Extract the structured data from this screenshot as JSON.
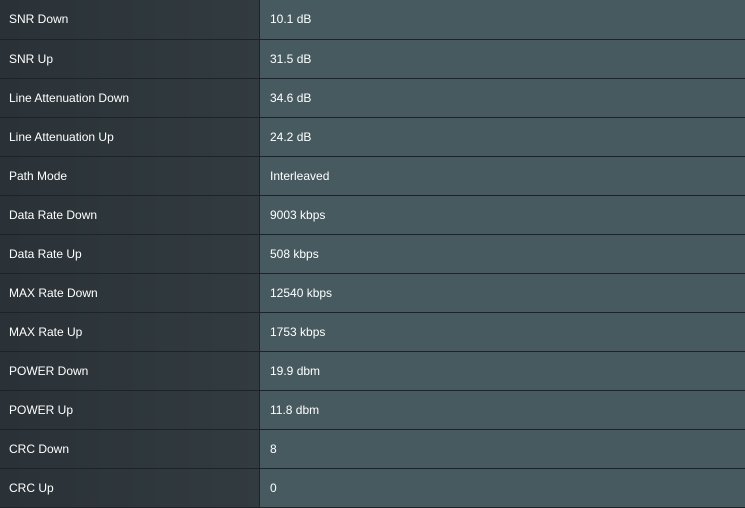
{
  "rows": [
    {
      "label": "SNR Down",
      "value": "10.1 dB"
    },
    {
      "label": "SNR Up",
      "value": "31.5 dB"
    },
    {
      "label": "Line Attenuation Down",
      "value": "34.6 dB"
    },
    {
      "label": "Line Attenuation Up",
      "value": "24.2 dB"
    },
    {
      "label": "Path Mode",
      "value": "Interleaved"
    },
    {
      "label": "Data Rate Down",
      "value": "9003 kbps"
    },
    {
      "label": "Data Rate Up",
      "value": "508 kbps"
    },
    {
      "label": "MAX Rate Down",
      "value": "12540 kbps"
    },
    {
      "label": "MAX Rate Up",
      "value": "1753 kbps"
    },
    {
      "label": "POWER Down",
      "value": "19.9 dbm"
    },
    {
      "label": "POWER Up",
      "value": "11.8 dbm"
    },
    {
      "label": "CRC Down",
      "value": "8"
    },
    {
      "label": "CRC Up",
      "value": "0"
    }
  ],
  "colors": {
    "label_bg": "#2f383d",
    "value_bg": "#475a5f",
    "border": "#1d2326",
    "text": "#ffffff"
  }
}
